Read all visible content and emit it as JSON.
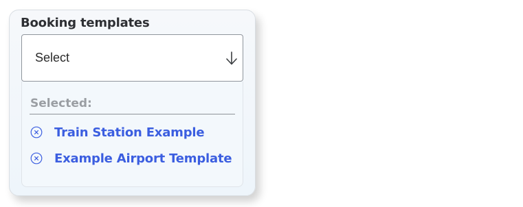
{
  "widget": {
    "title": "Booking templates",
    "select": {
      "value": "Select",
      "icon": "arrow-down-icon"
    },
    "selected_label": "Selected:",
    "selected_items": [
      {
        "label": "Train Station Example",
        "icon": "remove-circle-icon"
      },
      {
        "label": "Example Airport Template",
        "icon": "remove-circle-icon"
      }
    ]
  },
  "colors": {
    "accent": "#3b5ee0",
    "muted_text": "#9a9ea3",
    "title_text": "#2d2f33"
  }
}
